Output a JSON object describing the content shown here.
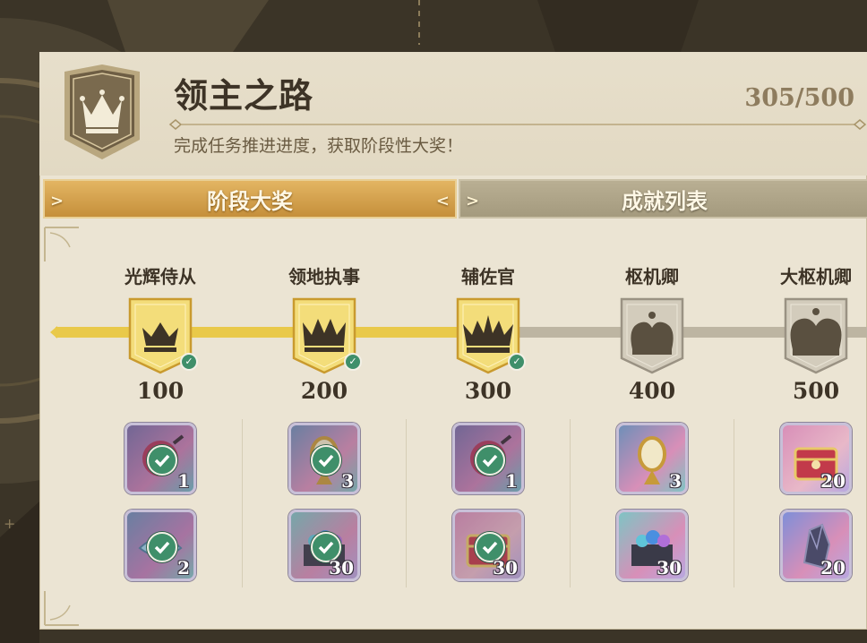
{
  "header": {
    "title": "领主之路",
    "subtitle": "完成任务推进进度，获取阶段性大奖！",
    "progress": "305/500"
  },
  "tabs": [
    {
      "label": "阶段大奖",
      "active": true
    },
    {
      "label": "成就列表",
      "active": false
    }
  ],
  "progress_track": {
    "current": 305,
    "max": 500
  },
  "tiers": [
    {
      "name": "光辉侍从",
      "points": "100",
      "reached": true,
      "icon": "crown-small-icon",
      "rewards": [
        {
          "qty": "1",
          "icon": "pink-orb-icon",
          "claimed": true
        },
        {
          "qty": "2",
          "icon": "blue-crystal-icon",
          "claimed": true
        }
      ]
    },
    {
      "name": "领地执事",
      "points": "200",
      "reached": true,
      "icon": "crown-medium-icon",
      "rewards": [
        {
          "qty": "3",
          "icon": "golden-mirror-icon",
          "claimed": true
        },
        {
          "qty": "30",
          "icon": "gem-chest-icon",
          "claimed": true
        }
      ]
    },
    {
      "name": "辅佐官",
      "points": "300",
      "reached": true,
      "icon": "crown-large-icon",
      "rewards": [
        {
          "qty": "1",
          "icon": "pink-orb-icon",
          "claimed": true
        },
        {
          "qty": "30",
          "icon": "red-chest-icon",
          "claimed": true
        }
      ]
    },
    {
      "name": "枢机卿",
      "points": "400",
      "reached": false,
      "icon": "royal-crown-icon",
      "rewards": [
        {
          "qty": "3",
          "icon": "golden-mirror-icon",
          "claimed": false
        },
        {
          "qty": "30",
          "icon": "gem-chest-icon",
          "claimed": false
        }
      ]
    },
    {
      "name": "大枢机卿",
      "points": "500",
      "reached": false,
      "icon": "imperial-crown-icon",
      "rewards": [
        {
          "qty": "20",
          "icon": "red-chest-icon",
          "claimed": false
        },
        {
          "qty": "20",
          "icon": "dark-crystal-icon",
          "claimed": false
        }
      ]
    }
  ],
  "colors": {
    "gold": "#e3b563",
    "track_fill": "#e9c94a",
    "track_empty": "#bdb5a2",
    "check_green": "#3f8f6a",
    "panel": "#ebe4d3"
  }
}
